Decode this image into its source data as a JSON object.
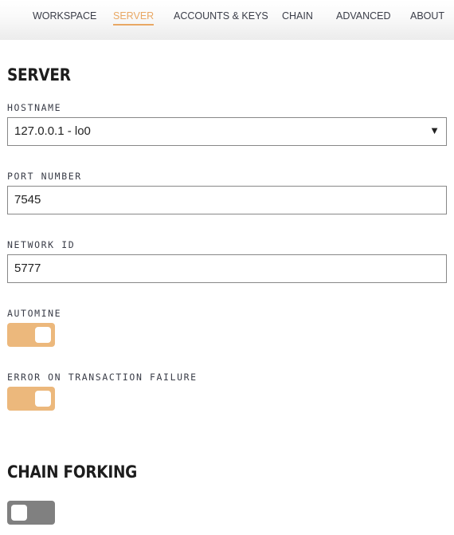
{
  "nav": {
    "tabs": [
      {
        "label": "WORKSPACE"
      },
      {
        "label": "SERVER",
        "active": true
      },
      {
        "label": "ACCOUNTS & KEYS"
      },
      {
        "label": "CHAIN"
      },
      {
        "label": "ADVANCED"
      },
      {
        "label": "ABOUT"
      }
    ]
  },
  "server": {
    "title": "SERVER",
    "hostname": {
      "label": "HOSTNAME",
      "value": "127.0.0.1 - lo0",
      "icon": "dropdown-arrow-icon"
    },
    "port": {
      "label": "PORT NUMBER",
      "value": "7545"
    },
    "network_id": {
      "label": "NETWORK ID",
      "value": "5777"
    },
    "automine": {
      "label": "AUTOMINE",
      "enabled": true
    },
    "error_on_failure": {
      "label": "ERROR ON TRANSACTION FAILURE",
      "enabled": true
    }
  },
  "chain_forking": {
    "title": "CHAIN FORKING",
    "enabled": false
  },
  "colors": {
    "accent": "#e9a864",
    "toggle_on": "#ecb87c",
    "toggle_off": "#808080"
  }
}
